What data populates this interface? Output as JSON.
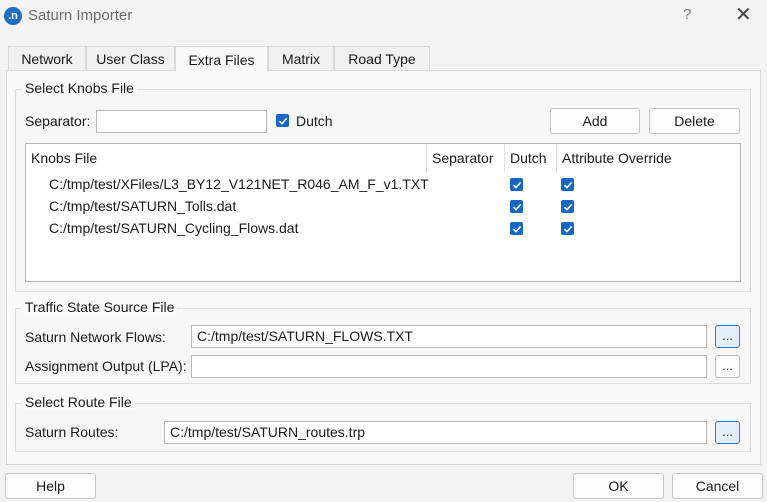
{
  "window": {
    "app_icon": ".n",
    "title": "Saturn Importer",
    "help_label": "?",
    "close_label": "✕"
  },
  "tabs": [
    {
      "label": "Network",
      "active": false
    },
    {
      "label": "User Class",
      "active": false
    },
    {
      "label": "Extra Files",
      "active": true
    },
    {
      "label": "Matrix",
      "active": false
    },
    {
      "label": "Road Type",
      "active": false
    }
  ],
  "knobs": {
    "group_title": "Select Knobs File",
    "separator_label": "Separator:",
    "separator_value": "",
    "dutch_label": "Dutch",
    "dutch_checked": true,
    "add_label": "Add",
    "delete_label": "Delete",
    "columns": [
      "Knobs File",
      "Separator",
      "Dutch",
      "Attribute Override"
    ],
    "rows": [
      {
        "file": "C:/tmp/test/XFiles/L3_BY12_V121NET_R046_AM_F_v1.TXT",
        "separator": "",
        "dutch": true,
        "override": true
      },
      {
        "file": "C:/tmp/test/SATURN_Tolls.dat",
        "separator": "",
        "dutch": true,
        "override": true
      },
      {
        "file": "C:/tmp/test/SATURN_Cycling_Flows.dat",
        "separator": "",
        "dutch": true,
        "override": true
      }
    ]
  },
  "traffic": {
    "group_title": "Traffic State Source File",
    "network_flows_label": "Saturn Network Flows:",
    "network_flows_value": "C:/tmp/test/SATURN_FLOWS.TXT",
    "assignment_label": "Assignment Output (LPA):",
    "assignment_value": "",
    "browse_label": "..."
  },
  "route": {
    "group_title": "Select Route File",
    "routes_label": "Saturn Routes:",
    "routes_value": "C:/tmp/test/SATURN_routes.trp",
    "browse_label": "..."
  },
  "footer": {
    "help_label": "Help",
    "ok_label": "OK",
    "cancel_label": "Cancel"
  },
  "colors": {
    "accent": "#1668c1",
    "highlight_button_bg": "#e3effb",
    "highlight_button_border": "#2f7fd0"
  }
}
